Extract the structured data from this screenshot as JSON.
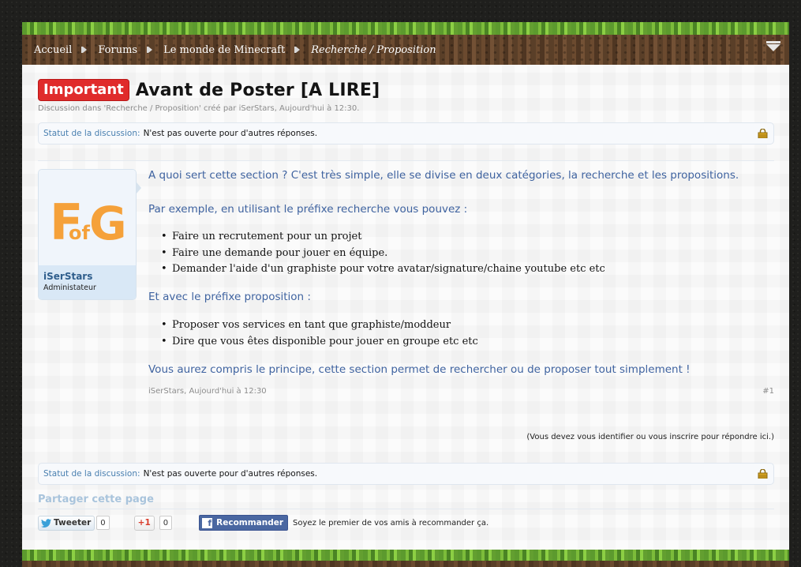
{
  "breadcrumb": {
    "items": [
      "Accueil",
      "Forums",
      "Le monde de Minecraft"
    ],
    "current": "Recherche / Proposition"
  },
  "thread": {
    "prefix": "Important",
    "title": "Avant de Poster [A LIRE]",
    "meta": "Discussion dans 'Recherche / Proposition' créé par iSerStars, Aujourd'hui à 12:30."
  },
  "status": {
    "label": "Statut de la discussion:",
    "value": "N'est pas ouverte pour d'autres réponses."
  },
  "author": {
    "avatar_text": "FofG",
    "name": "iSerStars",
    "title": "Administateur"
  },
  "post": {
    "intro": "A quoi sert cette section ? C'est très simple, elle se divise en deux catégories, la recherche et les propositions.",
    "example": "Par exemple, en utilisant le préfixe recherche vous pouvez :",
    "list1": [
      "Faire un recrutement pour un projet",
      "Faire une demande pour jouer en équipe.",
      "Demander l'aide d'un graphiste pour votre avatar/signature/chaine youtube etc etc"
    ],
    "proposition": "Et avec le préfixe proposition :",
    "list2": [
      "Proposer vos services en tant que graphiste/moddeur",
      "Dire que vous êtes disponible pour jouer en groupe etc etc"
    ],
    "conclusion": "Vous aurez compris le principe, cette section permet de rechercher ou de proposer tout simplement !",
    "footer_author_date": "iSerStars, Aujourd'hui à 12:30",
    "permalink": "#1"
  },
  "login_note": "(Vous devez vous identifier ou vous inscrire pour répondre ici.)",
  "share": {
    "title": "Partager cette page",
    "tweet_label": "Tweeter",
    "tweet_count": "0",
    "gplus_label": "+1",
    "gplus_count": "0",
    "fb_label": "Recommander",
    "fb_text": "Soyez le premier de vos amis à recommander ça."
  },
  "colors": {
    "prefix_bg": "#e02b2b",
    "link_blue": "#3f63a0",
    "avatar_orange": "#f5a13a"
  }
}
